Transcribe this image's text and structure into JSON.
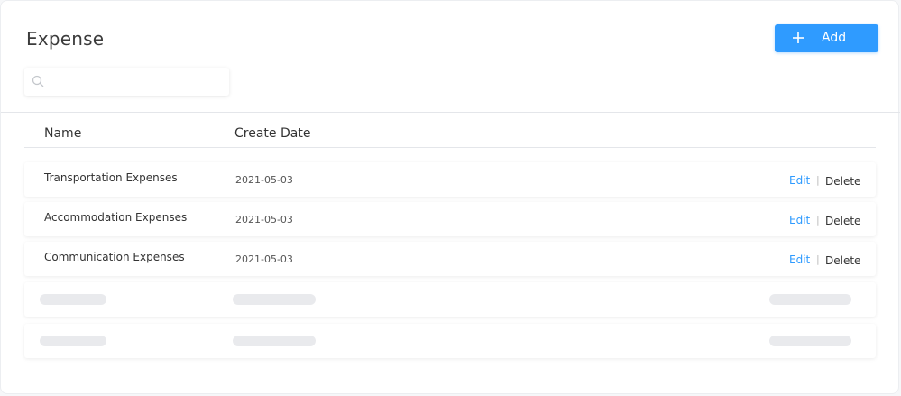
{
  "header": {
    "title": "Expense",
    "add_label": "Add"
  },
  "search": {
    "placeholder": "",
    "value": ""
  },
  "table": {
    "columns": [
      "Name",
      "Create Date"
    ],
    "rows": [
      {
        "name": "Transportation Expenses",
        "date": "2021-05-03",
        "edit": "Edit",
        "delete": "Delete"
      },
      {
        "name": "Accommodation Expenses",
        "date": "2021-05-03",
        "edit": "Edit",
        "delete": "Delete"
      },
      {
        "name": "Communication Expenses",
        "date": "2021-05-03",
        "edit": "Edit",
        "delete": "Delete"
      }
    ],
    "separator": "|"
  },
  "colors": {
    "accent": "#2f9bff",
    "skeleton": "#e9eaed"
  },
  "icons": {
    "add": "plus-icon",
    "search": "search-icon"
  }
}
